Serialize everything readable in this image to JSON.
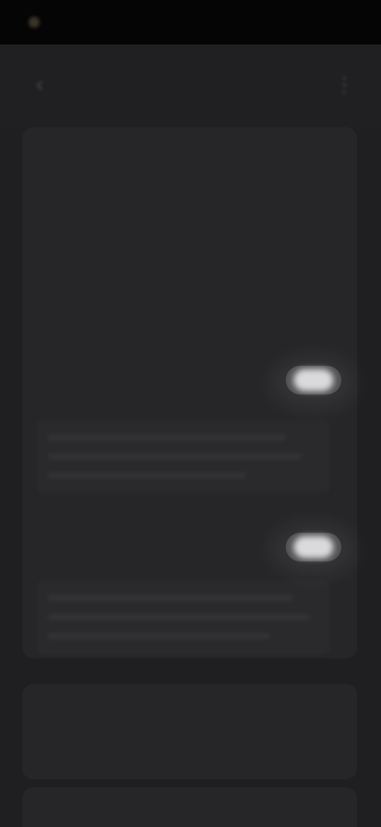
{
  "status_bar": {
    "time": "",
    "icons": ""
  },
  "header": {
    "back_icon": "back-arrow-icon",
    "title": "",
    "menu_icon": "more-menu-icon"
  },
  "settings": {
    "section_1": "",
    "row_1_label": "",
    "row_1_value": "",
    "row_2_label": "",
    "row_2_value": "",
    "row_3_label": "",
    "row_3_value": "",
    "section_2": "",
    "toggle_1_label": "",
    "toggle_1_state": true,
    "toggle_2_label": "",
    "toggle_2_state": true,
    "bottom_title": "",
    "bottom_desc": "",
    "last_label": ""
  },
  "colors": {
    "background": "#1f1f21",
    "card": "#262628",
    "toggle_on": "#d8d8da"
  }
}
